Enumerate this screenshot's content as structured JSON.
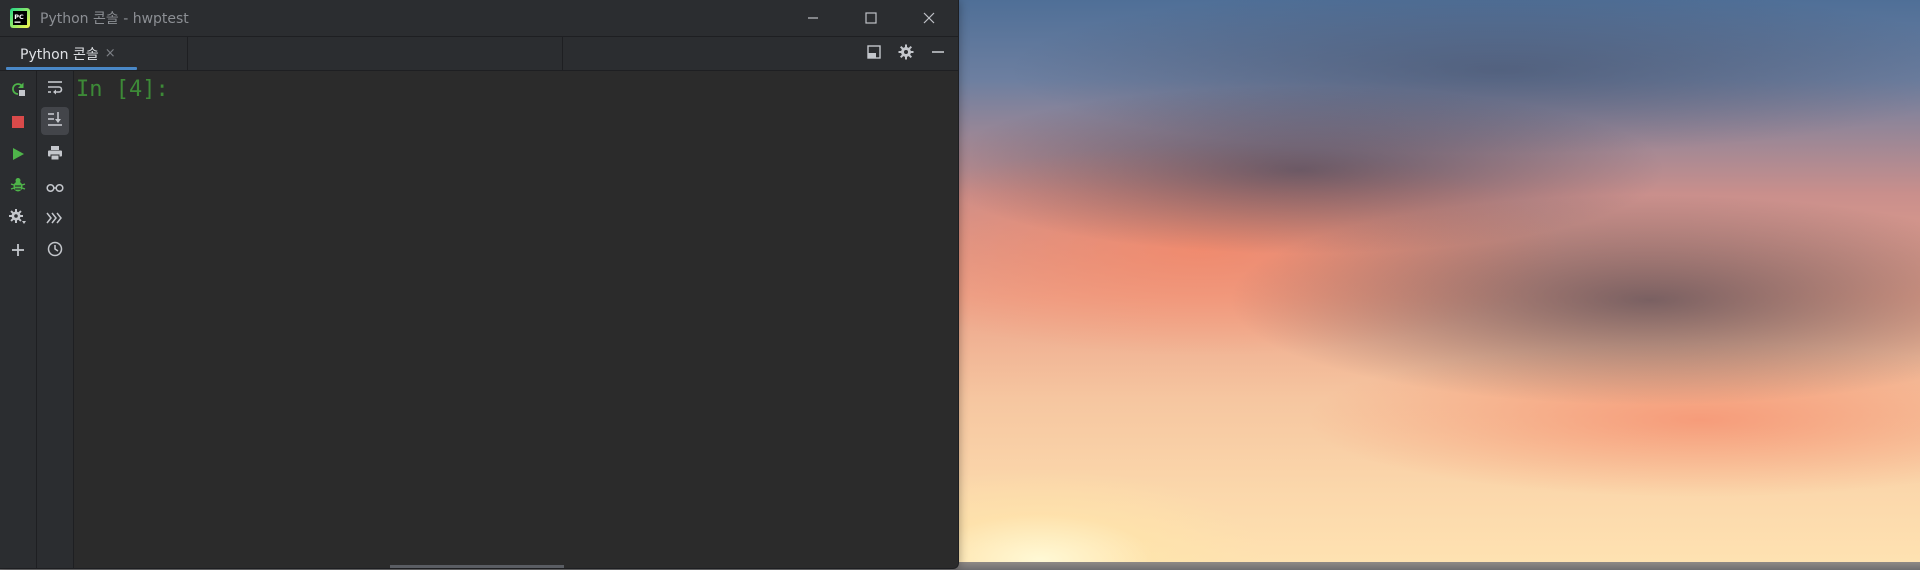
{
  "window": {
    "title": "Python 콘솔 - hwptest",
    "logo_text": "PC"
  },
  "tabs": [
    {
      "label": "Python 콘솔",
      "close": "×"
    }
  ],
  "console": {
    "prompt": "In [4]:"
  },
  "icons": {
    "titlebar": [
      "pycharm-logo-icon",
      "minimize-icon",
      "maximize-icon",
      "close-icon"
    ],
    "tab_tools": [
      "layout-icon",
      "gear-icon",
      "hide-icon"
    ],
    "toolbar_left": [
      "rerun-icon",
      "stop-icon",
      "run-icon",
      "debug-icon",
      "settings-icon",
      "add-icon"
    ],
    "toolbar_left_2": [
      "soft-wrap-icon",
      "scroll-to-end-icon",
      "print-icon",
      "view-variables-icon",
      "execute-queue-icon",
      "history-icon"
    ]
  },
  "colors": {
    "accent": "#4a88c7",
    "prompt": "#3d8a37",
    "run_green": "#4fb54a",
    "stop_red": "#d94a4a"
  }
}
